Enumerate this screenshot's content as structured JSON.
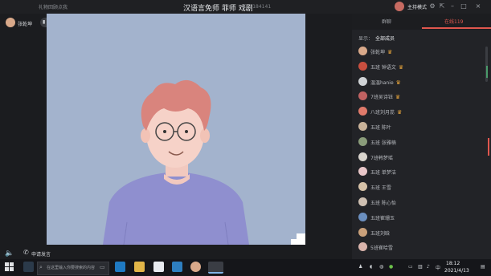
{
  "topbar": {
    "gift_link": "礼物回顾点我",
    "title": "汉语言免师 菲师 戏剧",
    "room_id": "ID:2184141",
    "host_mode": "主持模式",
    "icons": [
      "host-avatar",
      "settings-icon",
      "export-icon",
      "minimize-icon",
      "maximize-icon",
      "close-icon"
    ]
  },
  "presenter": {
    "name": "张乾坤",
    "mic_label": "排麦"
  },
  "bottom_controls": {
    "apply_speak": "申请发言"
  },
  "right_panel": {
    "tabs": [
      "群聊",
      "在线119"
    ],
    "active_tab": 1,
    "filter_label": "显示：",
    "filter_value": "全部成员",
    "users": [
      {
        "name": "张乾坤",
        "badge": true,
        "color": "#d9a98a"
      },
      {
        "name": "五班 钟语文",
        "badge": true,
        "color": "#c94f3f"
      },
      {
        "name": "温温hanie",
        "badge": true,
        "color": "#d0d3d6"
      },
      {
        "name": "7班吴诗钰",
        "badge": true,
        "color": "#c06262"
      },
      {
        "name": "八班刘月蕊",
        "badge": true,
        "color": "#e07a6a"
      },
      {
        "name": "五班 陈叶",
        "badge": false,
        "color": "#c9b39a"
      },
      {
        "name": "五班 张雅楠",
        "badge": false,
        "color": "#8a9c7a"
      },
      {
        "name": "7班韩梦瑶",
        "badge": false,
        "color": "#d8d3cc"
      },
      {
        "name": "五班 单梦洁",
        "badge": false,
        "color": "#e8c6c8"
      },
      {
        "name": "五班 王雪",
        "badge": false,
        "color": "#d6c2a8"
      },
      {
        "name": "五班 陈心怡",
        "badge": false,
        "color": "#cfc0b2"
      },
      {
        "name": "五班崔珊玉",
        "badge": false,
        "color": "#6b8fbf"
      },
      {
        "name": "五班刘晗",
        "badge": false,
        "color": "#c9a07a"
      },
      {
        "name": "5班崔哈雪",
        "badge": false,
        "color": "#d9b4ac"
      }
    ]
  },
  "taskbar": {
    "search_placeholder": "在这里输入你要搜索的内容",
    "time": "18:12",
    "date": "2021/4/13",
    "tray_lang": "中",
    "app_icons": [
      "chrome-like-app",
      "edge",
      "file-explorer",
      "notes",
      "photos",
      "avatar-app",
      "video-app"
    ]
  },
  "colors": {
    "accent": "#e0574e",
    "video_bg": "#a3b3cd"
  }
}
